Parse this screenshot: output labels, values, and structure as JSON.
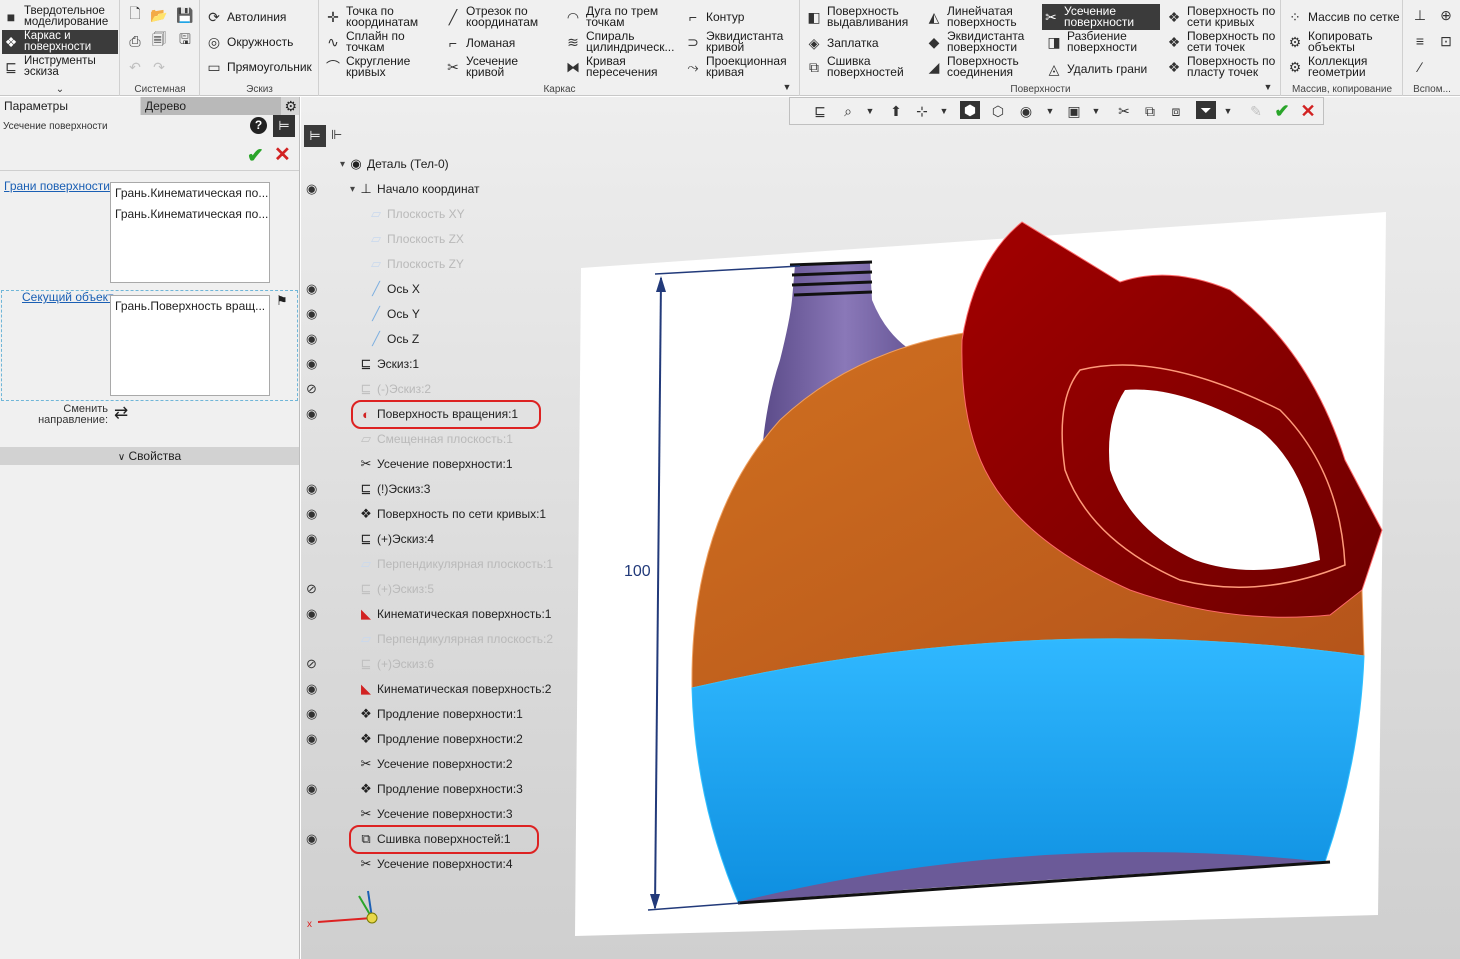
{
  "ribbon": {
    "mode": [
      {
        "label": "Твердотельное моделирование",
        "icon": "solid-icon"
      },
      {
        "label": "Каркас и поверхности",
        "icon": "surface-icon"
      },
      {
        "label": "Инструменты эскиза",
        "icon": "sketch-icon"
      }
    ],
    "groups": {
      "system": "Системная",
      "sketch": "Эскиз",
      "frame": "Каркас",
      "surfaces": "Поверхности",
      "array": "Массив, копирование",
      "aux": "Вспом..."
    },
    "sketch_tools": [
      "Автолиния",
      "Окружность",
      "Прямоугольник"
    ],
    "frame_tools": [
      "Точка по координатам",
      "Сплайн по точкам",
      "Скругление кривых",
      "Отрезок по координатам",
      "Ломаная",
      "Усечение кривой",
      "Дуга по трем точкам",
      "Спираль цилиндрическ...",
      "Кривая пересечения",
      "Контур",
      "Эквидистанта кривой",
      "Проекционная кривая"
    ],
    "surface_tools": [
      "Поверхность выдавливания",
      "Заплатка",
      "Сшивка поверхностей",
      "Линейчатая поверхность",
      "Эквидистанта поверхности",
      "Поверхность соединения",
      "Усечение поверхности",
      "Разбиение поверхности",
      "Удалить грани",
      "Поверхность по сети кривых",
      "Поверхность по сети точек",
      "Поверхность по пласту точек"
    ],
    "array_tools": [
      "Массив по сетке",
      "Копировать объекты",
      "Коллекция геометрии"
    ]
  },
  "panel": {
    "tab_params": "Параметры",
    "tab_tree": "Дерево",
    "command": "Усечение поверхности",
    "faces_label": "Грани поверхности",
    "faces": [
      "Грань.Кинематическая по...",
      "Грань.Кинематическая по..."
    ],
    "cutter_label": "Секущий объект",
    "cutter": [
      "Грань.Поверхность вращ..."
    ],
    "switch_dir_1": "Сменить",
    "switch_dir_2": "направление:",
    "properties": "Свойства"
  },
  "tree": [
    {
      "label": "Деталь (Тел-0)",
      "icon": "part-icon",
      "dim": false,
      "eye": false,
      "indent": 0
    },
    {
      "label": "Начало координат",
      "icon": "origin-icon",
      "dim": false,
      "eye": true,
      "indent": 1
    },
    {
      "label": "Плоскость XY",
      "icon": "plane-icon",
      "dim": true,
      "eye": false,
      "indent": 2
    },
    {
      "label": "Плоскость ZX",
      "icon": "plane-icon",
      "dim": true,
      "eye": false,
      "indent": 2
    },
    {
      "label": "Плоскость ZY",
      "icon": "plane-icon",
      "dim": true,
      "eye": false,
      "indent": 2
    },
    {
      "label": "Ось X",
      "icon": "axis-icon",
      "dim": false,
      "eye": true,
      "indent": 2
    },
    {
      "label": "Ось Y",
      "icon": "axis-icon",
      "dim": false,
      "eye": true,
      "indent": 2
    },
    {
      "label": "Ось Z",
      "icon": "axis-icon",
      "dim": false,
      "eye": true,
      "indent": 2
    },
    {
      "label": "Эскиз:1",
      "icon": "sketch-icon",
      "dim": false,
      "eye": true,
      "indent": 1
    },
    {
      "label": "(-)Эскиз:2",
      "icon": "sketch-icon",
      "dim": true,
      "eye": "hidden",
      "indent": 1
    },
    {
      "label": "Поверхность вращения:1",
      "icon": "revolve-icon",
      "dim": false,
      "eye": true,
      "indent": 1,
      "circled": true
    },
    {
      "label": "Смещенная плоскость:1",
      "icon": "offset-plane-icon",
      "dim": true,
      "eye": false,
      "indent": 1
    },
    {
      "label": "Усечение поверхности:1",
      "icon": "trim-icon",
      "dim": false,
      "eye": false,
      "indent": 1
    },
    {
      "label": "(!)Эскиз:3",
      "icon": "sketch-icon",
      "dim": false,
      "eye": true,
      "indent": 1
    },
    {
      "label": "Поверхность по сети кривых:1",
      "icon": "mesh-surface-icon",
      "dim": false,
      "eye": true,
      "indent": 1
    },
    {
      "label": "(+)Эскиз:4",
      "icon": "sketch-icon",
      "dim": false,
      "eye": true,
      "indent": 1
    },
    {
      "label": "Перпендикулярная плоскость:1",
      "icon": "plane-icon",
      "dim": true,
      "eye": false,
      "indent": 1
    },
    {
      "label": "(+)Эскиз:5",
      "icon": "sketch-icon",
      "dim": true,
      "eye": "hidden",
      "indent": 1
    },
    {
      "label": "Кинематическая поверхность:1",
      "icon": "sweep-icon",
      "dim": false,
      "eye": true,
      "indent": 1
    },
    {
      "label": "Перпендикулярная плоскость:2",
      "icon": "plane-icon",
      "dim": true,
      "eye": false,
      "indent": 1
    },
    {
      "label": "(+)Эскиз:6",
      "icon": "sketch-icon",
      "dim": true,
      "eye": "hidden",
      "indent": 1
    },
    {
      "label": "Кинематическая поверхность:2",
      "icon": "sweep-icon",
      "dim": false,
      "eye": true,
      "indent": 1
    },
    {
      "label": "Продление поверхности:1",
      "icon": "extend-icon",
      "dim": false,
      "eye": true,
      "indent": 1
    },
    {
      "label": "Продление поверхности:2",
      "icon": "extend-icon",
      "dim": false,
      "eye": true,
      "indent": 1
    },
    {
      "label": "Усечение поверхности:2",
      "icon": "trim-icon",
      "dim": false,
      "eye": false,
      "indent": 1
    },
    {
      "label": "Продление поверхности:3",
      "icon": "extend-icon",
      "dim": false,
      "eye": true,
      "indent": 1
    },
    {
      "label": "Усечение поверхности:3",
      "icon": "trim-icon",
      "dim": false,
      "eye": false,
      "indent": 1
    },
    {
      "label": "Сшивка поверхностей:1",
      "icon": "stitch-icon",
      "dim": false,
      "eye": true,
      "indent": 1,
      "circled": true
    },
    {
      "label": "Усечение поверхности:4",
      "icon": "trim-icon",
      "dim": false,
      "eye": false,
      "indent": 1
    }
  ],
  "model": {
    "dimension": "100"
  },
  "colors": {
    "accent_red": "#d22222",
    "surface_orange": "#c8621c",
    "surface_blue": "#1ea6f0",
    "surface_darkred": "#8e0000",
    "neck_purple": "#7a68a8",
    "ok_green": "#2aa52a"
  }
}
